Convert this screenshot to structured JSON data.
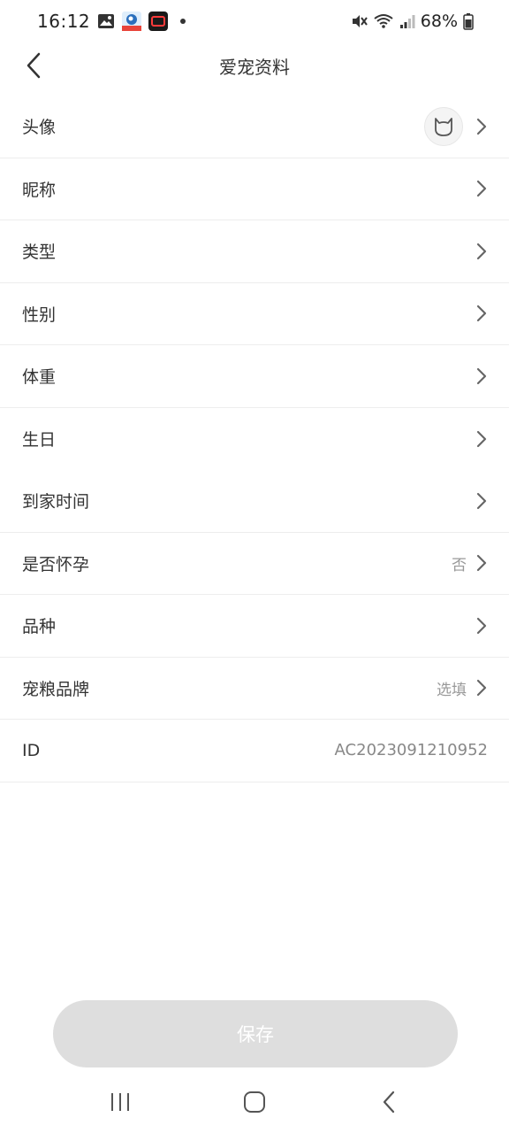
{
  "status_bar": {
    "time": "16:12",
    "battery": "68%"
  },
  "header": {
    "title": "爱宠资料"
  },
  "rows": [
    {
      "label": "头像",
      "value": ""
    },
    {
      "label": "昵称",
      "value": ""
    },
    {
      "label": "类型",
      "value": ""
    },
    {
      "label": "性别",
      "value": ""
    },
    {
      "label": "体重",
      "value": ""
    },
    {
      "label": "生日",
      "value": ""
    },
    {
      "label": "到家时间",
      "value": ""
    },
    {
      "label": "是否怀孕",
      "value": "否"
    },
    {
      "label": "品种",
      "value": ""
    },
    {
      "label": "宠粮品牌",
      "value": "选填"
    },
    {
      "label": "ID",
      "value": "AC2023091210952"
    }
  ],
  "save_button": {
    "label": "保存"
  },
  "colors": {
    "text_primary": "#333333",
    "text_secondary": "#999999",
    "button_disabled": "#dedede",
    "divider": "#ededed"
  }
}
